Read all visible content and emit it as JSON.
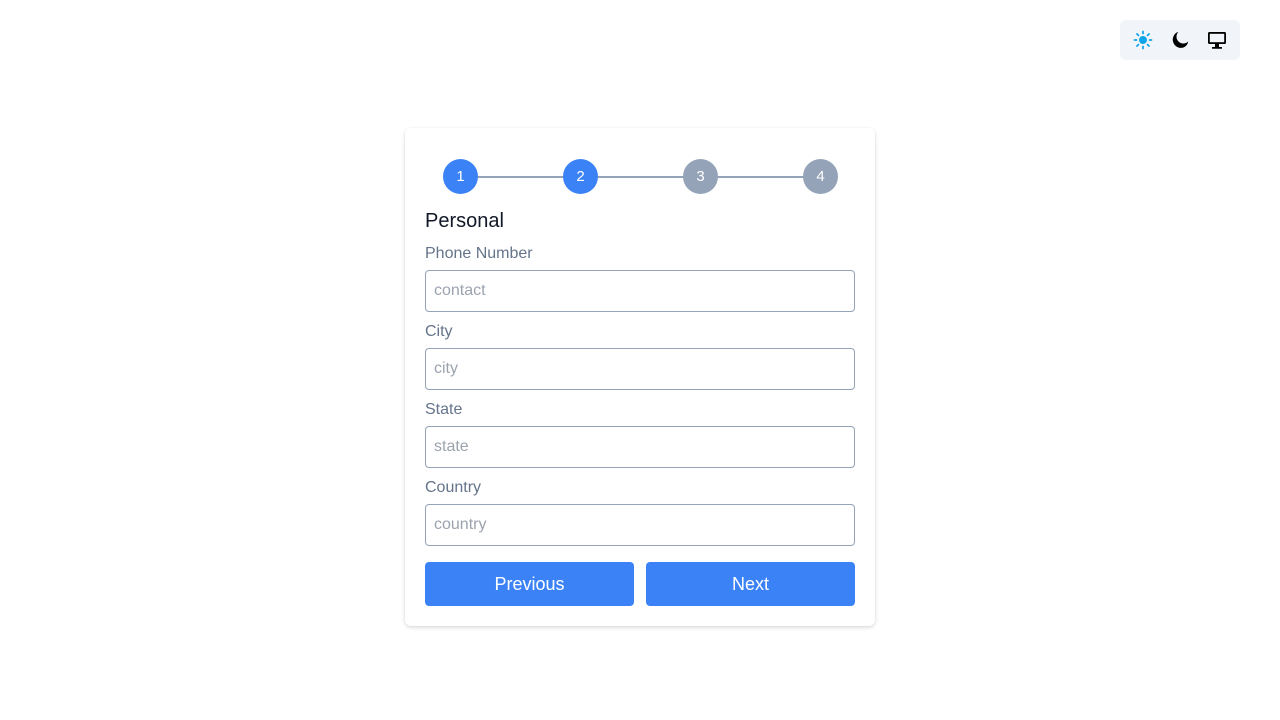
{
  "theme_switcher": {
    "options": [
      {
        "icon": "sun-icon",
        "active": true
      },
      {
        "icon": "moon-icon",
        "active": false
      },
      {
        "icon": "monitor-icon",
        "active": false
      }
    ],
    "active_color": "#0ea5e9"
  },
  "stepper": {
    "steps": [
      "1",
      "2",
      "3",
      "4"
    ],
    "current_step": 2,
    "active_color": "#3b82f6",
    "inactive_color": "#94a3b8"
  },
  "form": {
    "title": "Personal",
    "fields": [
      {
        "label": "Phone Number",
        "placeholder": "contact",
        "value": ""
      },
      {
        "label": "City",
        "placeholder": "city",
        "value": ""
      },
      {
        "label": "State",
        "placeholder": "state",
        "value": ""
      },
      {
        "label": "Country",
        "placeholder": "country",
        "value": ""
      }
    ],
    "buttons": {
      "previous": "Previous",
      "next": "Next"
    }
  }
}
